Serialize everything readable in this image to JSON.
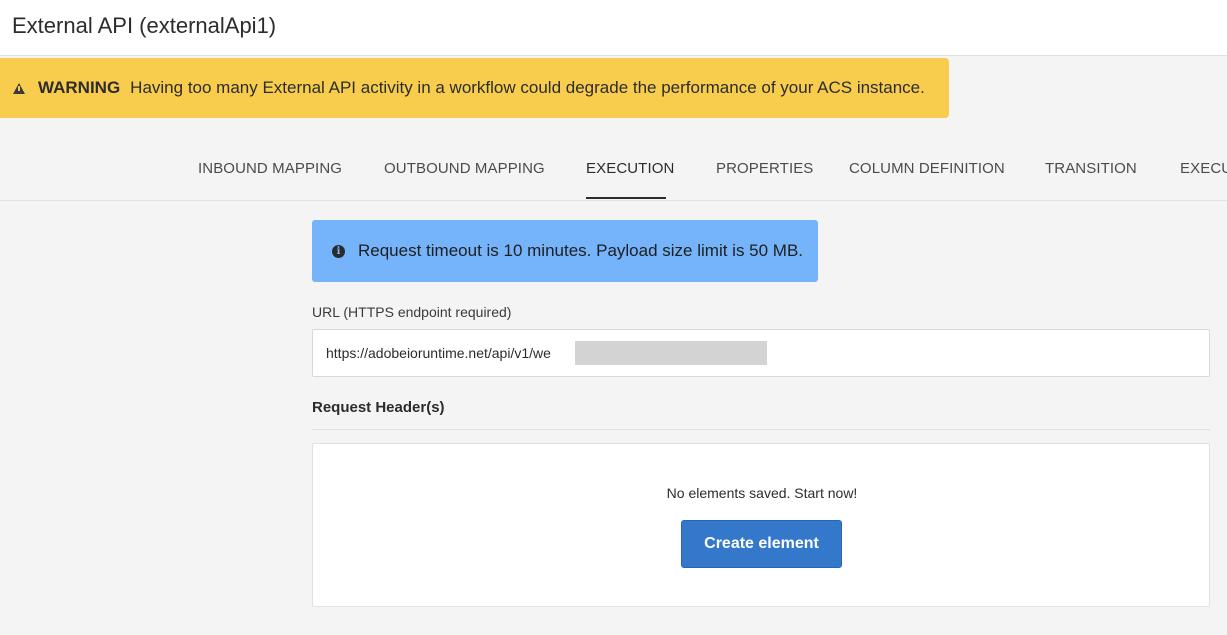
{
  "window": {
    "title": "External API (externalApi1)"
  },
  "warning": {
    "label": "WARNING",
    "text": "Having too many External API activity in a workflow could degrade the performance of your ACS instance.",
    "color": "#f8cd4d"
  },
  "tabs": [
    {
      "label": "INBOUND MAPPING",
      "active": false
    },
    {
      "label": "OUTBOUND MAPPING",
      "active": false
    },
    {
      "label": "EXECUTION",
      "active": true
    },
    {
      "label": "PROPERTIES",
      "active": false
    },
    {
      "label": "COLUMN DEFINITION",
      "active": false
    },
    {
      "label": "TRANSITION",
      "active": false
    },
    {
      "label": "EXECUT",
      "active": false
    }
  ],
  "info": {
    "icon": "info-icon",
    "text": "Request timeout is 10 minutes. Payload size limit is 50 MB.",
    "color": "#75b4fb"
  },
  "url": {
    "label": "URL (HTTPS endpoint required)",
    "value": "https://adobeioruntime.net/api/v1/we                                        ault/hello"
  },
  "request_headers": {
    "title": "Request Header(s)",
    "empty_text": "No elements saved. Start now!",
    "create_label": "Create element",
    "button_color": "#3478cc"
  }
}
